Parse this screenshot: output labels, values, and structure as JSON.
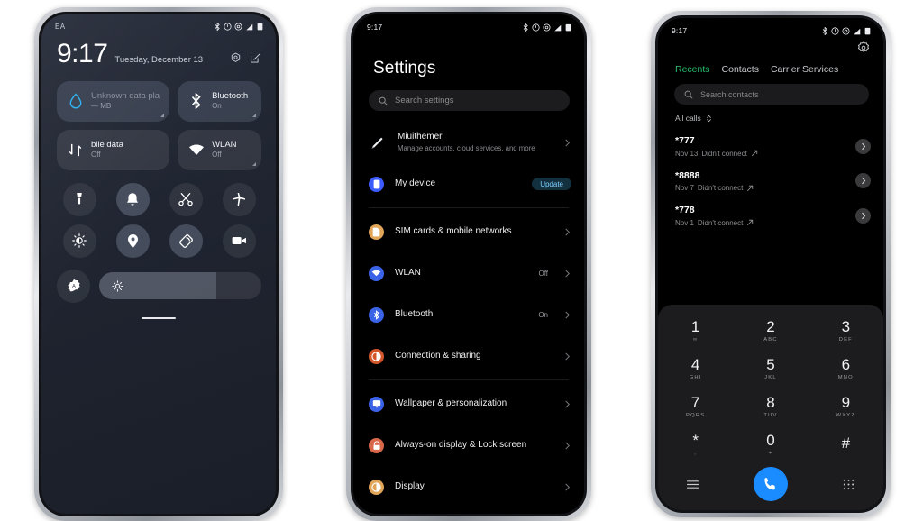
{
  "status_bar": {
    "carrier": "EA",
    "time": "9:17",
    "icons": [
      "bluetooth-icon",
      "alarm-icon",
      "dnd-icon",
      "signal-icon",
      "battery-icon"
    ]
  },
  "phone1": {
    "name": "control-center",
    "clock": "9:17",
    "date": "Tuesday, December 13",
    "header_icons": [
      "settings-gear-icon",
      "edit-icon"
    ],
    "tiles": [
      {
        "icon": "data-usage-drop-icon",
        "title": "Unknown data pla",
        "sub": "— MB",
        "state": "on",
        "dim_title": true
      },
      {
        "icon": "bluetooth-icon",
        "title": "Bluetooth",
        "sub": "On",
        "state": "on",
        "dim_title": false
      },
      {
        "icon": "mobile-data-icon",
        "title": "bile data",
        "sub": "Off",
        "state": "off",
        "dim_title": false
      },
      {
        "icon": "wlan-icon",
        "title": "WLAN",
        "sub": "Off",
        "state": "off",
        "dim_title": false
      }
    ],
    "toggles": [
      {
        "icon": "flashlight-icon",
        "state": "off"
      },
      {
        "icon": "bell-icon",
        "state": "on"
      },
      {
        "icon": "scissors-screenshot-icon",
        "state": "off"
      },
      {
        "icon": "airplane-icon",
        "state": "off"
      },
      {
        "icon": "brightness-icon",
        "state": "off"
      },
      {
        "icon": "location-pin-icon",
        "state": "on"
      },
      {
        "icon": "auto-rotate-icon",
        "state": "on"
      },
      {
        "icon": "screen-record-icon",
        "state": "off"
      },
      {
        "icon": "auto-brightness-gear-icon",
        "state": "off"
      }
    ],
    "brightness": {
      "icon": "brightness-slider-icon",
      "value_percent": 72
    },
    "home_indicator": true
  },
  "phone2": {
    "name": "settings-app",
    "title": "Settings",
    "search_placeholder": "Search settings",
    "account": {
      "icon": "account-avatar-icon",
      "name": "Miuithemer",
      "desc": "Manage accounts, cloud services, and more"
    },
    "device": {
      "icon": "my-device-icon",
      "label": "My device",
      "badge": "Update",
      "icon_color": "#3b5bff"
    },
    "group_a": [
      {
        "icon": "sim-card-icon",
        "label": "SIM cards & mobile networks",
        "value": "",
        "color": "#e0a558"
      },
      {
        "icon": "wlan-icon",
        "label": "WLAN",
        "value": "Off",
        "color": "#3b63e8"
      },
      {
        "icon": "bluetooth-icon",
        "label": "Bluetooth",
        "value": "On",
        "color": "#3b63e8"
      },
      {
        "icon": "connection-sharing-icon",
        "label": "Connection & sharing",
        "value": "",
        "color": "#d4572c"
      }
    ],
    "group_b": [
      {
        "icon": "wallpaper-icon",
        "label": "Wallpaper & personalization",
        "value": "",
        "color": "#3b63e8"
      },
      {
        "icon": "lock-screen-icon",
        "label": "Always-on display & Lock screen",
        "value": "",
        "color": "#d9674a"
      },
      {
        "icon": "display-icon",
        "label": "Display",
        "value": "",
        "color": "#e0a558"
      }
    ]
  },
  "phone3": {
    "name": "dialer-app",
    "gear_icon": "settings-gear-icon",
    "tabs": [
      {
        "label": "Recents",
        "active": true
      },
      {
        "label": "Contacts",
        "active": false
      },
      {
        "label": "Carrier Services",
        "active": false
      }
    ],
    "active_tab_color": "#2bbd6e",
    "search_placeholder": "Search contacts",
    "filter_label": "All calls",
    "calls": [
      {
        "number": "*777",
        "date": "Nov 13",
        "status": "Didn't connect",
        "direction": "outgoing"
      },
      {
        "number": "*8888",
        "date": "Nov 7",
        "status": "Didn't connect",
        "direction": "outgoing"
      },
      {
        "number": "*778",
        "date": "Nov 1",
        "status": "Didn't connect",
        "direction": "outgoing"
      }
    ],
    "keypad": [
      {
        "num": "1",
        "sub": "∞"
      },
      {
        "num": "2",
        "sub": "ABC"
      },
      {
        "num": "3",
        "sub": "DEF"
      },
      {
        "num": "4",
        "sub": "GHI"
      },
      {
        "num": "5",
        "sub": "JKL"
      },
      {
        "num": "6",
        "sub": "MNO"
      },
      {
        "num": "7",
        "sub": "PQRS"
      },
      {
        "num": "8",
        "sub": "TUV"
      },
      {
        "num": "9",
        "sub": "WXYZ"
      },
      {
        "num": "*",
        "sub": ","
      },
      {
        "num": "0",
        "sub": "+"
      },
      {
        "num": "#",
        "sub": ""
      }
    ],
    "actions": {
      "left_icon": "menu-icon",
      "call_icon": "call-icon",
      "right_icon": "keypad-icon",
      "call_button_color": "#1a8cff"
    }
  }
}
